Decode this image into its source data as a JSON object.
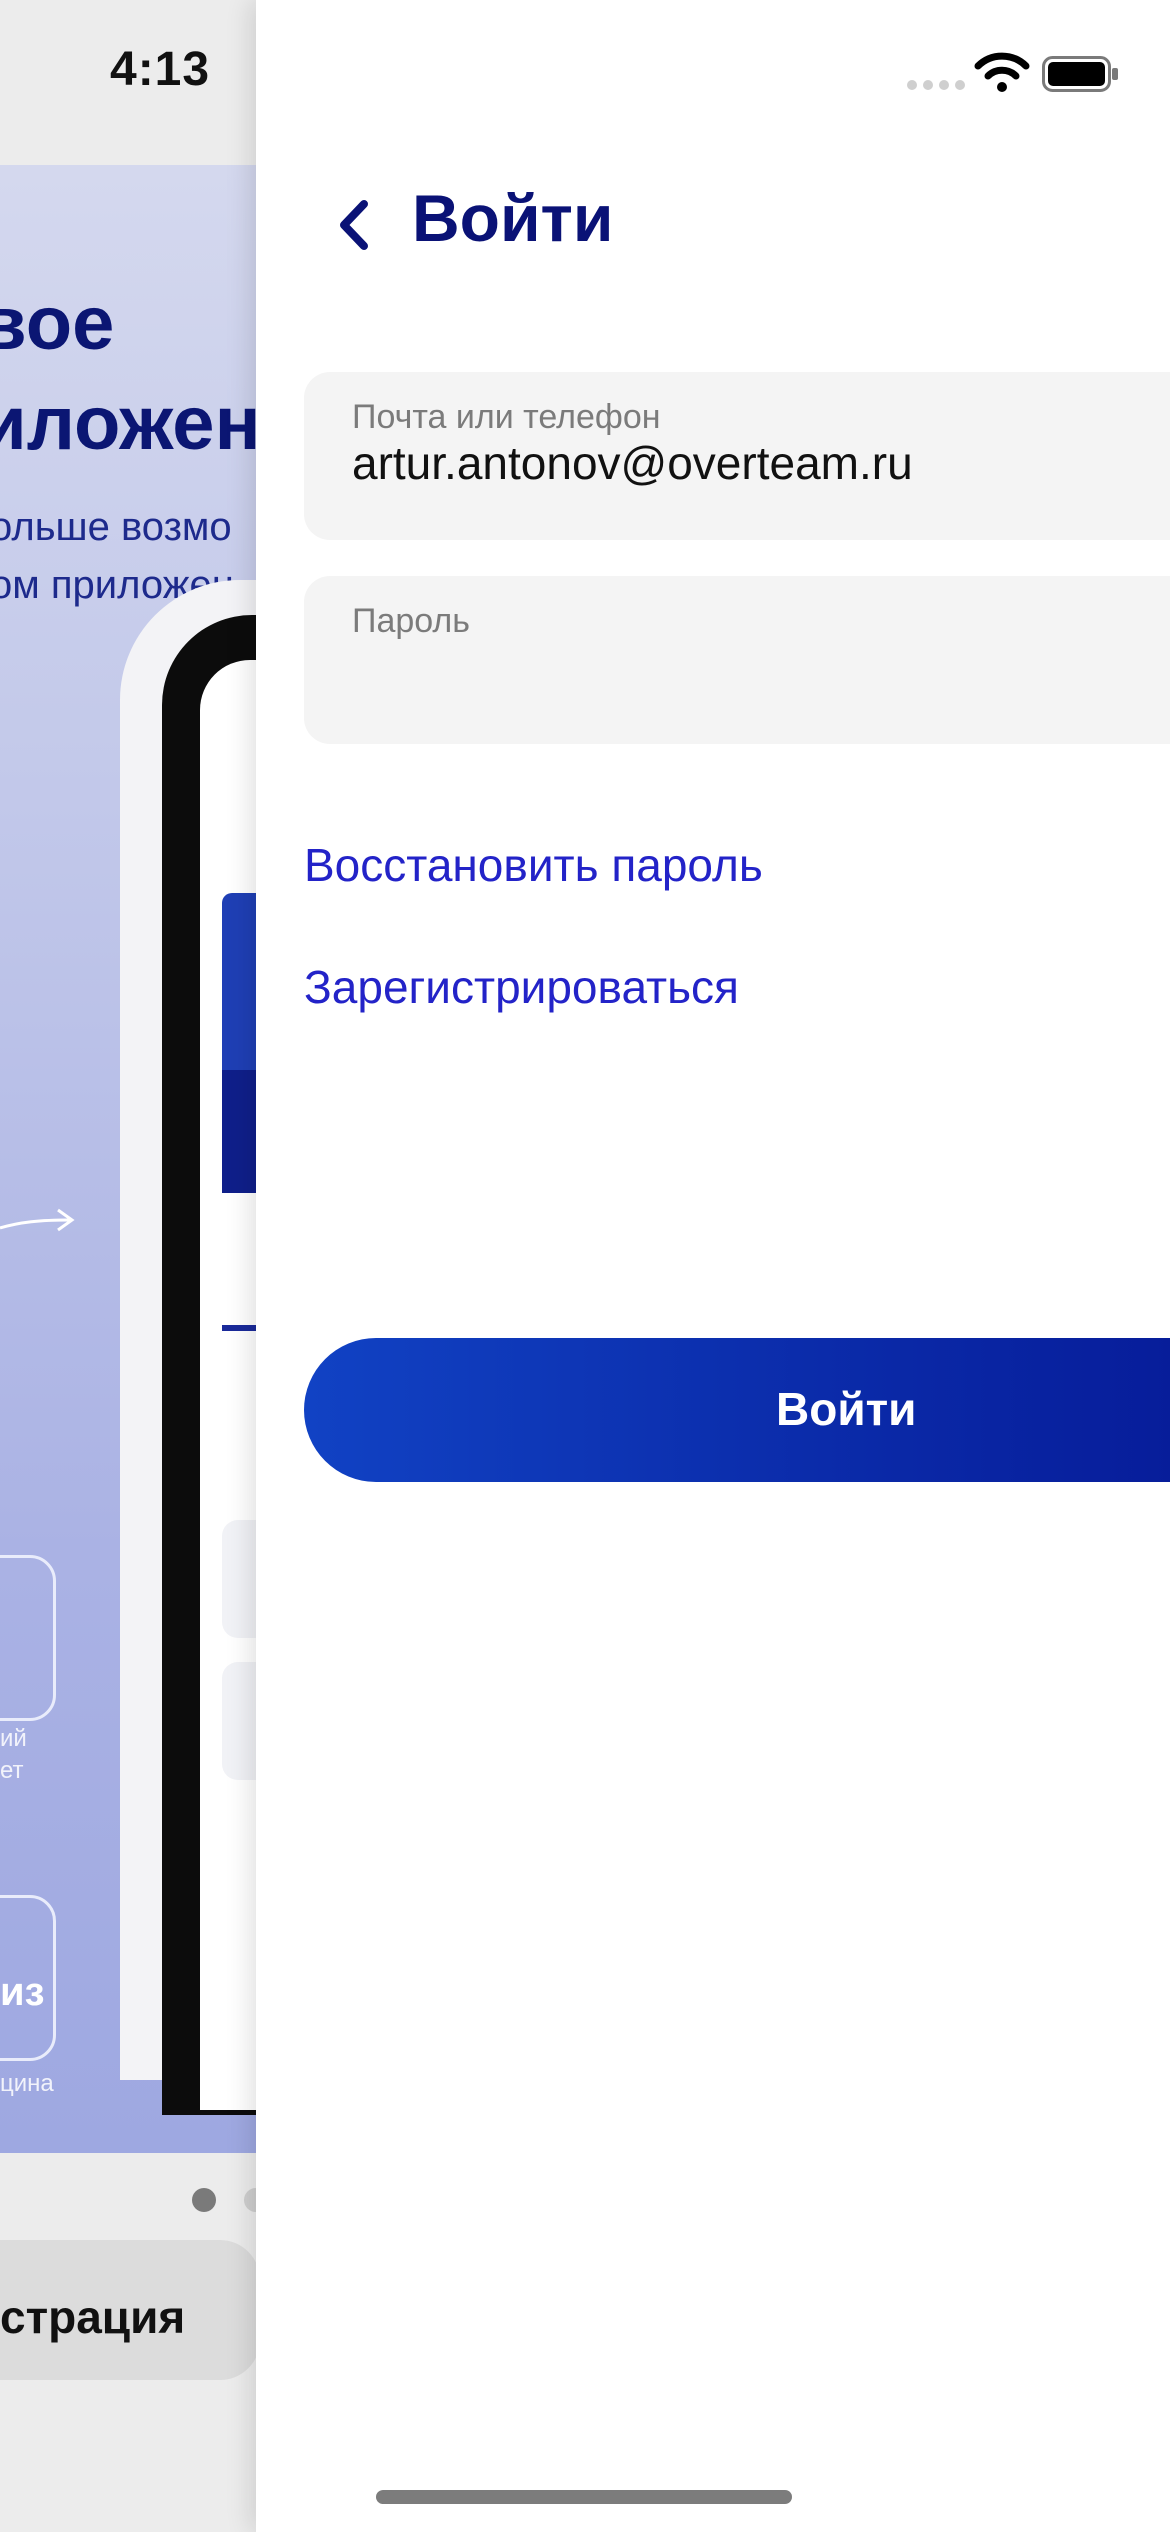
{
  "background": {
    "status_time": "4:13",
    "title_line1": "вое",
    "title_line2": "иложен",
    "subtitle_line1": "ольше возмо",
    "subtitle_line2": "ом приложен",
    "tile_labels": [
      "ий",
      "ет",
      "цина"
    ],
    "tile_glyph": "из",
    "register_label": "страция"
  },
  "screen": {
    "title": "Войти",
    "fields": {
      "email": {
        "label": "Почта или телефон",
        "value": "artur.antonov@overteam.ru"
      },
      "password": {
        "label": "Пароль",
        "value": ""
      }
    },
    "links": {
      "restore_password": "Восстановить пароль",
      "register": "Зарегистрироваться"
    },
    "submit_label": "Войти"
  },
  "colors": {
    "title": "#0a1276",
    "link": "#2323c8",
    "button_start": "#1142c4",
    "button_end": "#061a97",
    "field_bg": "#f4f4f4"
  },
  "icons": {
    "back": "chevron-left-icon",
    "signal": "signal-icon",
    "wifi": "wifi-icon",
    "battery": "battery-icon"
  }
}
